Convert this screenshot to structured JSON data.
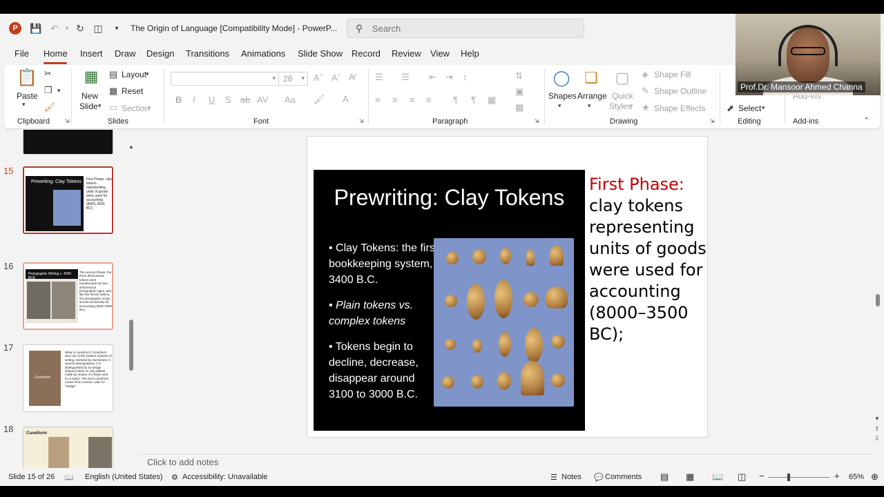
{
  "titlebar": {
    "doc_title": "The Origin of Language [Compatibility Mode]  -  PowerP...",
    "search_placeholder": "Search",
    "app_logo": "P"
  },
  "tabs": [
    "File",
    "Home",
    "Insert",
    "Draw",
    "Design",
    "Transitions",
    "Animations",
    "Slide Show",
    "Record",
    "Review",
    "View",
    "Help"
  ],
  "active_tab": "Home",
  "ribbon": {
    "clipboard": {
      "paste": "Paste",
      "label": "Clipboard"
    },
    "slides": {
      "new_slide": "New",
      "new_slide2": "Slide",
      "layout": "Layout",
      "reset": "Reset",
      "section": "Section",
      "label": "Slides"
    },
    "font": {
      "font_name": "",
      "font_size": "28",
      "label": "Font",
      "bold": "B",
      "italic": "I",
      "underline": "U",
      "strike": "S",
      "strikethrough": "ab",
      "spacing": "AV",
      "case": "Aa"
    },
    "paragraph": {
      "label": "Paragraph"
    },
    "drawing": {
      "shapes": "Shapes",
      "arrange": "Arrange",
      "quick_styles1": "Quick",
      "quick_styles2": "Styles",
      "shape_fill": "Shape Fill",
      "shape_outline": "Shape Outline",
      "shape_effects": "Shape Effects",
      "label": "Drawing"
    },
    "editing": {
      "select": "Select",
      "label": "Editing"
    },
    "addins": {
      "label": "Add-ins",
      "addins_btn": "Add-ins"
    }
  },
  "thumbnails": [
    {
      "num": "15",
      "title": "Prewriting: Clay Tokens",
      "text": "First Phase: clay tokens representing units of goods were used for accounting (8000–3500 BC);"
    },
    {
      "num": "16",
      "title": "Pictographic Writing c. 4000 BCE",
      "text": "The second Phase: the three dimensional tokens were transformed into two-dimensional pictographic signs, and like the former tokens, the pictographic script served exclusively for accounting (3500–3000 BC);"
    },
    {
      "num": "17",
      "title": "Cuneiform",
      "text": "What is cuneiform? Cuneiform was one of the earliest systems of writing, invented by Sumerians in ancient Mesopotamia. It is distinguished by its wedge shaped marks on clay tablets, made by means of a blunt reed for a stylus. The term cuneiform comes from cuneus, Latin for \"wedge\"."
    },
    {
      "num": "18",
      "title": "Cuneiform",
      "text": ""
    }
  ],
  "slide": {
    "image_title": "Prewriting: Clay Tokens",
    "bullets": [
      "Clay Tokens: the first bookkeeping system, 3400 B.C.",
      "Plain tokens vs. complex tokens",
      "Tokens begin to decline, decrease, disappear around 3100 to 3000 B.C."
    ],
    "phase_label": "First Phase:",
    "phase_text": "clay tokens representing units of goods were used for accounting (8000–3500 BC);"
  },
  "notes_placeholder": "Click to add notes",
  "statusbar": {
    "slide_info": "Slide 15 of 26",
    "language": "English (United States)",
    "accessibility": "Accessibility: Unavailable",
    "notes": "Notes",
    "comments": "Comments",
    "zoom": "65%"
  },
  "webcam": {
    "name": "Prof.Dr. Mansoor Ahmed Channa"
  },
  "colors": {
    "accent": "#c43e1c",
    "slide_red": "#c00000"
  }
}
